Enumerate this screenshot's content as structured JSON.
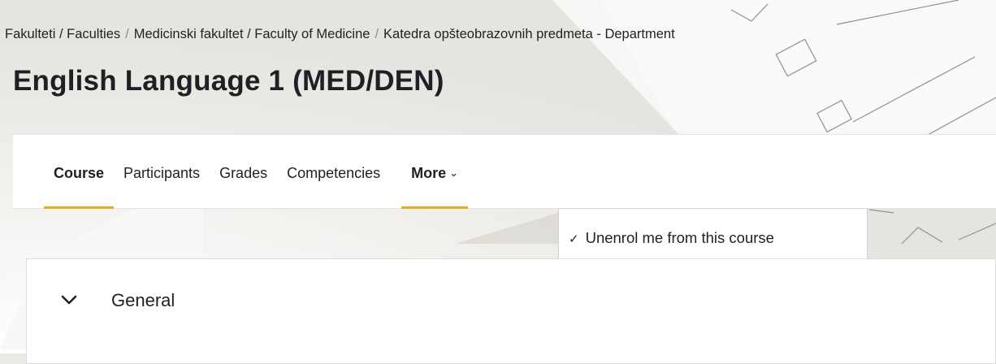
{
  "breadcrumb": {
    "items": [
      "Fakulteti / Faculties",
      "Medicinski fakultet / Faculty of Medicine",
      "Katedra opšteobrazovnih predmeta - Department"
    ],
    "separator": "/"
  },
  "course": {
    "title": "English Language 1 (MED/DEN)"
  },
  "nav": {
    "tabs": [
      {
        "label": "Course",
        "active": true
      },
      {
        "label": "Participants"
      },
      {
        "label": "Grades"
      },
      {
        "label": "Competencies"
      }
    ],
    "more_label": "More",
    "dropdown": {
      "items": [
        {
          "label": "Unenrol me from this course",
          "icon": "check-icon"
        }
      ]
    }
  },
  "section": {
    "title": "General",
    "expanded": true
  },
  "colors": {
    "accent": "#e0b020",
    "text": "#1d2125",
    "background": "#eceae6"
  }
}
